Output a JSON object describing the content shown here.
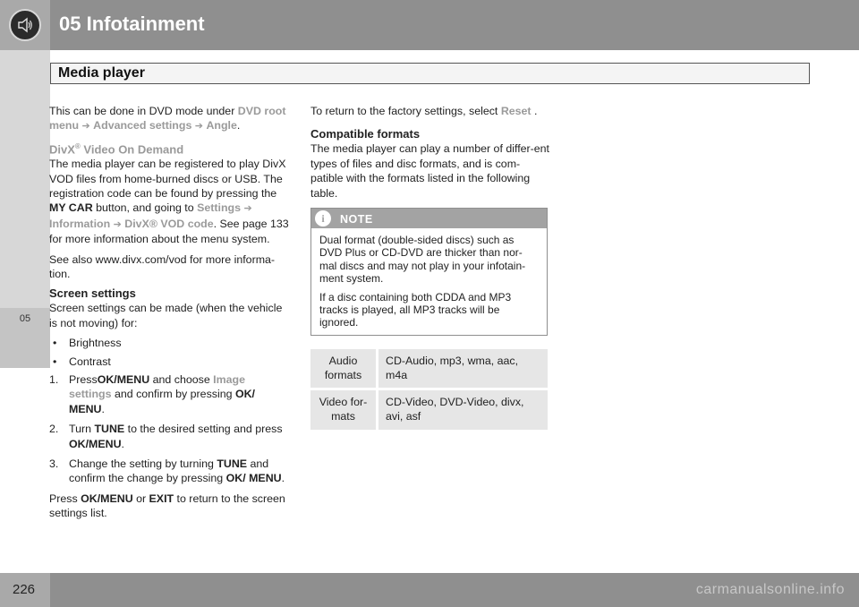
{
  "header": {
    "chapter_title": "05  Infotainment",
    "icon": "speaker-icon"
  },
  "section": {
    "title": "Media player"
  },
  "side_tab": {
    "label": "05"
  },
  "footer": {
    "page_number": "226",
    "watermark": "carmanualsonline.info"
  },
  "left": {
    "intro_text": "This can be done in DVD mode under ",
    "intro_path": [
      "DVD root menu",
      "Advanced settings",
      "Angle"
    ],
    "intro_end": ".",
    "divx_heading": "DivX",
    "divx_sup": "®",
    "divx_heading_rest": " Video On Demand",
    "divx_p1_a": "The media player can be registered to play DivX VOD files from home-burned discs or USB. The registration code can be found by pressing the ",
    "divx_p1_btn": "MY CAR",
    "divx_p1_b": " button, and going to ",
    "divx_path": [
      "Settings",
      "Information",
      "DivX® VOD code"
    ],
    "divx_p1_c": ". See page 133 for more information about the menu system.",
    "divx_p2": "See also www.divx.com/vod for more informa-tion.",
    "screen_heading": "Screen settings",
    "screen_intro": "Screen settings can be made (when the vehicle is not moving) for:",
    "bullets": [
      "Brightness",
      "Contrast"
    ],
    "steps": [
      {
        "num": "1.",
        "a": "Press",
        "b1": "OK/MENU",
        "c": " and choose ",
        "g": "Image settings",
        "d": " and confirm by pressing ",
        "b2": "OK/ MENU",
        "e": "."
      },
      {
        "num": "2.",
        "a": "Turn ",
        "b1": "TUNE",
        "c": " to the desired setting and press ",
        "b2": "OK/MENU",
        "e": "."
      },
      {
        "num": "3.",
        "a": "Change the setting by turning ",
        "b1": "TUNE",
        "c": " and confirm the change by pressing ",
        "b2": "OK/ MENU",
        "e": "."
      }
    ],
    "closing_a": "Press ",
    "closing_b1": "OK/MENU",
    "closing_or": " or ",
    "closing_b2": "EXIT",
    "closing_c": " to return to the screen settings list."
  },
  "right": {
    "factory_a": "To return to the factory settings, select ",
    "factory_reset": "Reset",
    "factory_end": " .",
    "compat_heading": "Compatible formats",
    "compat_text": "The media player can play a number of differ-ent types of files and disc formats, and is com-patible with the formats listed in the following table.",
    "note": {
      "title": "NOTE",
      "icon": "info-icon",
      "p1": "Dual format (double-sided discs) such as DVD Plus or CD-DVD are thicker than nor-mal discs and may not play in your infotain-ment system.",
      "p2": "If a disc containing both CDDA and MP3 tracks is played, all MP3 tracks will be ignored."
    },
    "formats": [
      {
        "label": "Audio formats",
        "value": "CD-Audio, mp3, wma, aac, m4a"
      },
      {
        "label": "Video for-mats",
        "value": "CD-Video, DVD-Video, divx, avi, asf"
      }
    ]
  }
}
